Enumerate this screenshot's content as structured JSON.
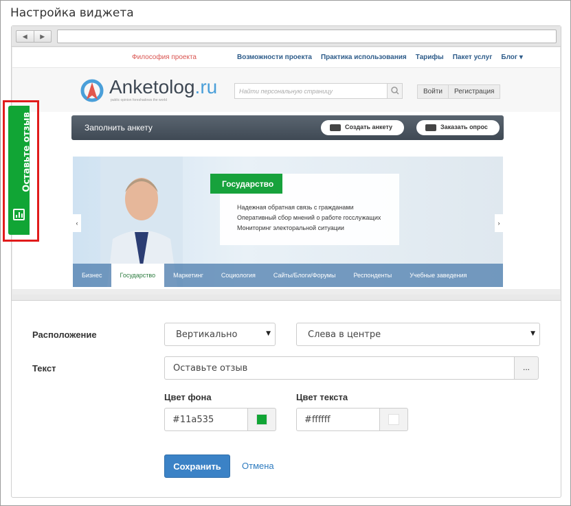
{
  "dialog": {
    "title": "Настройка виджета"
  },
  "browser": {
    "back_icon": "chevron-left-icon",
    "forward_icon": "chevron-right-icon",
    "url": ""
  },
  "site": {
    "philosophy_link": "Философия проекта",
    "top_nav": [
      "Возможности проекта",
      "Практика использования",
      "Тарифы",
      "Пакет услуг",
      "Блог ▾"
    ],
    "logo_main": "Anketolog",
    "logo_suffix": ".ru",
    "logo_tagline": "public opinion foreshadows the world",
    "search_placeholder": "Найти персональную страницу",
    "login_label": "Войти",
    "register_label": "Регистрация",
    "dark_bar_label": "Заполнить анкету",
    "create_survey_label": "Создать анкету",
    "order_survey_label": "Заказать опрос",
    "hero": {
      "badge": "Государство",
      "lines": [
        "Надежная обратная связь с гражданами",
        "Оперативный сбор мнений о работе госслужащих",
        "Мониторинг электоральной ситуации"
      ],
      "tabs": [
        "Бизнес",
        "Государство",
        "Маркетинг",
        "Социология",
        "Сайты/Блоги/Форумы",
        "Респонденты",
        "Учебные заведения"
      ],
      "active_tab_index": 1
    }
  },
  "widget": {
    "text": "Оставьте отзыв",
    "background_color": "#11a535",
    "text_color": "#ffffff",
    "highlight_color": "#e11b1b"
  },
  "form": {
    "position_label": "Расположение",
    "orientation_value": "Вертикально",
    "placement_value": "Слева в центре",
    "text_label": "Текст",
    "text_value": "Оставьте отзыв",
    "text_more_button": "...",
    "bg_color_label": "Цвет фона",
    "bg_color_value": "#11a535",
    "text_color_label": "Цвет текста",
    "text_color_value": "#ffffff",
    "save_button": "Сохранить",
    "cancel_link": "Отмена"
  }
}
